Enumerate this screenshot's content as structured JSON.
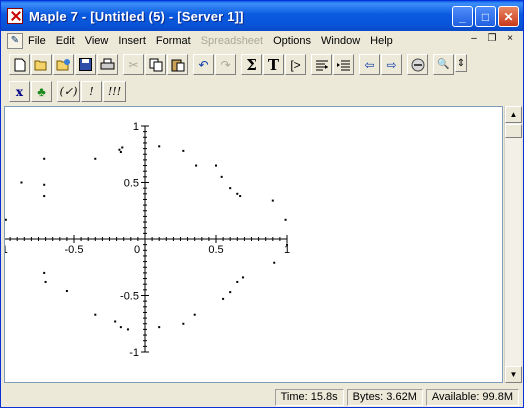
{
  "window": {
    "title": "Maple 7  - [Untitled (5) - [Server 1]]",
    "accent": "#0a5ae0"
  },
  "title_buttons": {
    "minimize": "_",
    "maximize": "□",
    "close": "✕"
  },
  "menubar": {
    "items": [
      {
        "label": "File",
        "enabled": true
      },
      {
        "label": "Edit",
        "enabled": true
      },
      {
        "label": "View",
        "enabled": true
      },
      {
        "label": "Insert",
        "enabled": true
      },
      {
        "label": "Format",
        "enabled": true
      },
      {
        "label": "Spreadsheet",
        "enabled": false
      },
      {
        "label": "Options",
        "enabled": true
      },
      {
        "label": "Window",
        "enabled": true
      },
      {
        "label": "Help",
        "enabled": true
      }
    ],
    "child_controls": {
      "minimize": "–",
      "restore": "❐",
      "close": "×"
    }
  },
  "toolbar1": {
    "groups": [
      [
        "new-icon",
        "open-icon",
        "open-url-icon",
        "save-icon",
        "print-icon"
      ],
      [
        "cut-icon",
        "copy-icon",
        "paste-icon"
      ],
      [
        "undo-icon",
        "redo-icon"
      ],
      [
        "sum-icon",
        "text-icon",
        "prompt-icon"
      ],
      [
        "exec-group-icon",
        "exec-all-icon"
      ],
      [
        "back-icon",
        "forward-icon"
      ],
      [
        "stop-icon"
      ],
      [
        "zoom-icon"
      ]
    ],
    "glyphs": {
      "sum": "Σ",
      "text": "T",
      "prompt": "[>",
      "back": "⇦",
      "forward": "⇨"
    }
  },
  "toolbar2": {
    "x_label": "x",
    "leaf_label": "♣",
    "check_label": "(✓)",
    "bang_label": "!",
    "bangs_label": "!!!"
  },
  "chart_data": {
    "type": "scatter",
    "title": "",
    "xlabel": "",
    "ylabel": "",
    "xlim": [
      -1,
      1
    ],
    "ylim": [
      -1,
      1
    ],
    "grid": false,
    "x_ticks": [
      "-1",
      "-0.5",
      "0",
      "0.5",
      "1"
    ],
    "y_ticks": [
      "1",
      "0.5",
      "0",
      "-0.5",
      "-1"
    ],
    "points": [
      [
        -0.71,
        0.71
      ],
      [
        -0.87,
        0.5
      ],
      [
        -0.98,
        0.17
      ],
      [
        -0.71,
        0.38
      ],
      [
        -0.71,
        0.48
      ],
      [
        -0.35,
        0.71
      ],
      [
        -0.17,
        0.77
      ],
      [
        -0.18,
        0.79
      ],
      [
        -0.16,
        0.81
      ],
      [
        0.1,
        0.82
      ],
      [
        0.27,
        0.78
      ],
      [
        0.36,
        0.65
      ],
      [
        0.5,
        0.65
      ],
      [
        0.54,
        0.55
      ],
      [
        0.6,
        0.45
      ],
      [
        0.65,
        0.4
      ],
      [
        0.67,
        0.38
      ],
      [
        0.9,
        0.34
      ],
      [
        0.99,
        0.17
      ],
      [
        1.0,
        -0.05
      ],
      [
        0.91,
        -0.21
      ],
      [
        0.69,
        -0.34
      ],
      [
        0.65,
        -0.38
      ],
      [
        0.6,
        -0.47
      ],
      [
        0.55,
        -0.53
      ],
      [
        0.35,
        -0.67
      ],
      [
        0.27,
        -0.75
      ],
      [
        0.1,
        -0.78
      ],
      [
        -0.12,
        -0.8
      ],
      [
        -0.17,
        -0.78
      ],
      [
        -0.21,
        -0.73
      ],
      [
        -0.35,
        -0.67
      ],
      [
        -0.55,
        -0.46
      ],
      [
        -0.7,
        -0.38
      ],
      [
        -0.71,
        -0.3
      ]
    ]
  },
  "statusbar": {
    "time": "Time:  15.8s",
    "bytes": "Bytes: 3.62M",
    "available": "Available: 99.8M"
  }
}
